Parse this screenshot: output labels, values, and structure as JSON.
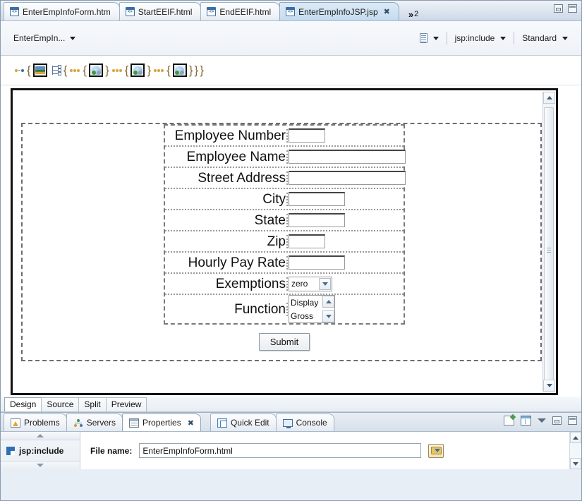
{
  "window": {
    "minimize_label": "minimize",
    "maximize_label": "maximize"
  },
  "editor_tabs": {
    "overflow_chevron": "»",
    "overflow_count": "2",
    "items": [
      {
        "label": "EnterEmpInfoForm.htm",
        "active": false,
        "icon": "html-file-icon"
      },
      {
        "label": "StartEEIF.html",
        "active": false,
        "icon": "html-file-icon"
      },
      {
        "label": "EndEEIF.html",
        "active": false,
        "icon": "html-file-icon"
      },
      {
        "label": "EnterEmpInfoJSP.jsp",
        "active": true,
        "icon": "jsp-file-icon",
        "close": "✖"
      }
    ]
  },
  "toolbar": {
    "document_selector": "EnterEmpIn...",
    "style_selector": "jsp:include",
    "standard_selector": "Standard",
    "page_icon": "page-icon"
  },
  "marker_strip": {
    "tokens": [
      "{",
      "{",
      "{",
      "}",
      "{",
      "}",
      "{",
      "}",
      "}",
      "}"
    ]
  },
  "design_form": {
    "rows": [
      {
        "label": "Employee Number",
        "control": "text",
        "size": "w-sm",
        "value": ""
      },
      {
        "label": "Employee Name",
        "control": "text",
        "size": "w-lg",
        "value": ""
      },
      {
        "label": "Street Address",
        "control": "text",
        "size": "w-lg",
        "value": ""
      },
      {
        "label": "City",
        "control": "text",
        "size": "w-md",
        "value": ""
      },
      {
        "label": "State",
        "control": "text",
        "size": "w-md",
        "value": ""
      },
      {
        "label": "Zip",
        "control": "text",
        "size": "w-sm",
        "value": ""
      },
      {
        "label": "Hourly Pay Rate",
        "control": "text",
        "size": "w-md",
        "value": ""
      },
      {
        "label": "Exemptions",
        "control": "select",
        "value": "zero"
      },
      {
        "label": "Function",
        "control": "listbox",
        "option1": "Display",
        "option2": "Gross"
      }
    ],
    "submit_label": "Submit"
  },
  "mode_tabs": {
    "items": [
      {
        "label": "Design",
        "active": true
      },
      {
        "label": "Source",
        "active": false
      },
      {
        "label": "Split",
        "active": false
      },
      {
        "label": "Preview",
        "active": false
      }
    ]
  },
  "bottom_panel": {
    "tabs": [
      {
        "label": "Problems",
        "icon": "problems-icon",
        "active": false
      },
      {
        "label": "Servers",
        "icon": "servers-icon",
        "active": false
      },
      {
        "label": "Properties",
        "icon": "properties-icon",
        "active": true,
        "close": "✖"
      },
      {
        "label": "Quick Edit",
        "icon": "quick-edit-icon",
        "active": false
      },
      {
        "label": "Console",
        "icon": "console-icon",
        "active": false
      }
    ],
    "properties": {
      "node_label": "jsp:include",
      "field_label": "File name:",
      "field_value": "EnterEmpInfoForm.html",
      "browse_icon": "folder-browse-icon"
    }
  }
}
